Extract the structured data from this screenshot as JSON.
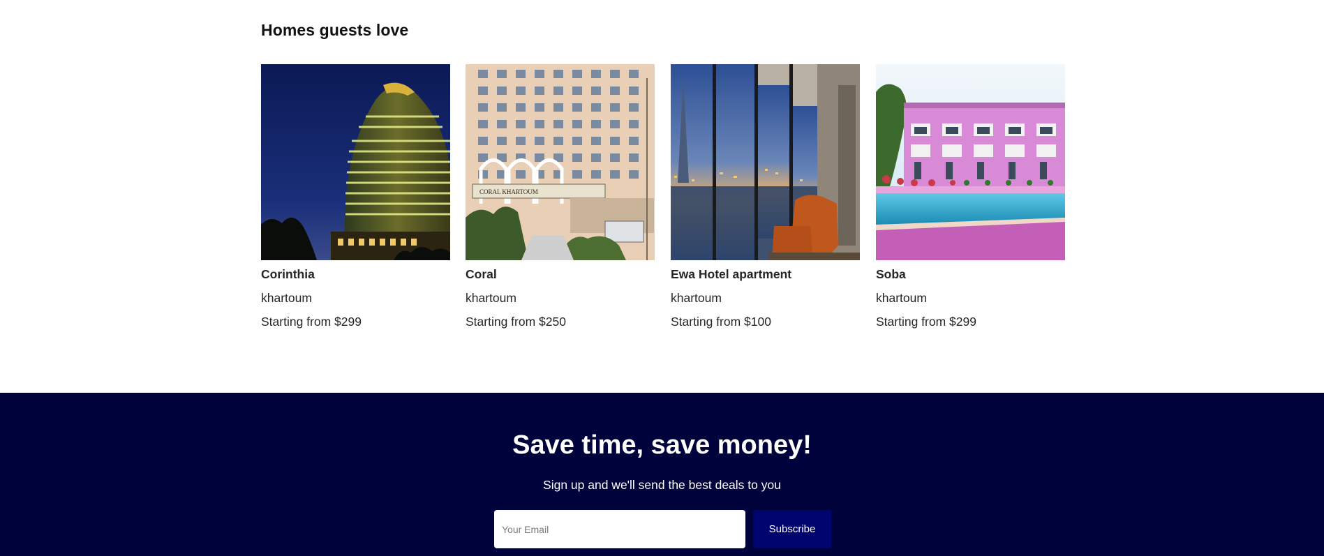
{
  "homes": {
    "title": "Homes guests love",
    "cards": [
      {
        "name": "Corinthia",
        "city": "khartoum",
        "price": "Starting from $299",
        "photo": "corinthia-hotel-night-photo"
      },
      {
        "name": "Coral",
        "city": "khartoum",
        "price": "Starting from $250",
        "photo": "coral-hotel-facade-photo",
        "sign_text": "CORAL KHARTOUM"
      },
      {
        "name": "Ewa Hotel apartment",
        "city": "khartoum",
        "price": "Starting from $100",
        "photo": "hotel-room-window-view-photo"
      },
      {
        "name": "Soba",
        "city": "khartoum",
        "price": "Starting from $299",
        "photo": "soba-hotel-pool-photo"
      }
    ]
  },
  "newsletter": {
    "title": "Save time, save money!",
    "subtitle": "Sign up and we'll send the best deals to you",
    "email_placeholder": "Your Email",
    "button_label": "Subscribe"
  },
  "colors": {
    "newsletter_bg": "#00023b",
    "button_bg": "#00046e",
    "text": "#262626"
  }
}
